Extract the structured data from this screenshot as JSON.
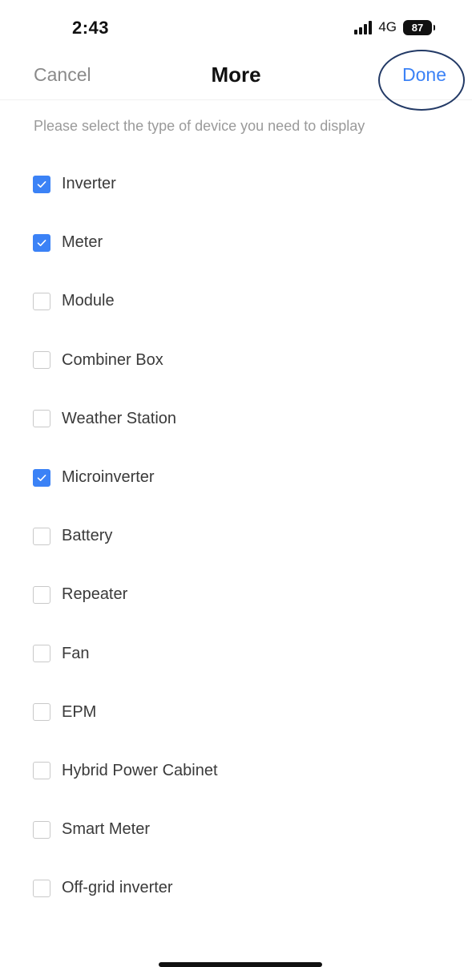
{
  "status_bar": {
    "time": "2:43",
    "network": "4G",
    "battery": "87",
    "signal_icon": "signal-bars-icon",
    "battery_icon": "battery-icon"
  },
  "nav": {
    "cancel_label": "Cancel",
    "title": "More",
    "done_label": "Done"
  },
  "instruction": "Please select the type of device you need to display",
  "colors": {
    "accent": "#3b82f6",
    "highlight_ring": "#233a66",
    "muted_text": "#8a8a8a"
  },
  "devices": [
    {
      "label": "Inverter",
      "checked": true
    },
    {
      "label": "Meter",
      "checked": true
    },
    {
      "label": "Module",
      "checked": false
    },
    {
      "label": "Combiner Box",
      "checked": false
    },
    {
      "label": "Weather Station",
      "checked": false
    },
    {
      "label": "Microinverter",
      "checked": true
    },
    {
      "label": "Battery",
      "checked": false
    },
    {
      "label": "Repeater",
      "checked": false
    },
    {
      "label": "Fan",
      "checked": false
    },
    {
      "label": "EPM",
      "checked": false
    },
    {
      "label": "Hybrid Power Cabinet",
      "checked": false
    },
    {
      "label": "Smart Meter",
      "checked": false
    },
    {
      "label": "Off-grid inverter",
      "checked": false
    }
  ]
}
